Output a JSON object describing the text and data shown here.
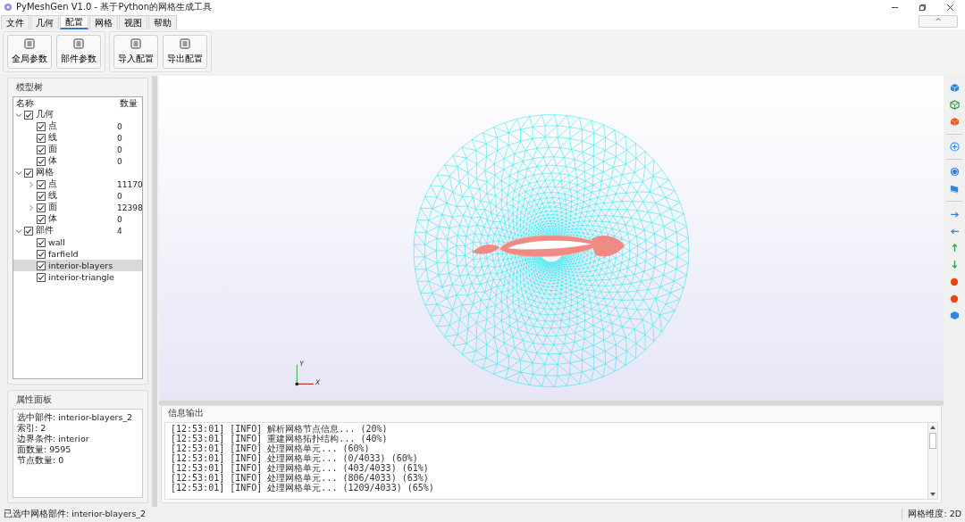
{
  "window": {
    "title": "PyMeshGen V1.0 - 基于Python的网格生成工具"
  },
  "menu_tabs": [
    {
      "label": "文件",
      "selected": false
    },
    {
      "label": "几何",
      "selected": false
    },
    {
      "label": "配置",
      "selected": true
    },
    {
      "label": "网格",
      "selected": false
    },
    {
      "label": "视图",
      "selected": false
    },
    {
      "label": "帮助",
      "selected": false
    }
  ],
  "collapse_button": {
    "label": "^"
  },
  "toolbar": {
    "groups": [
      [
        "全局参数",
        "部件参数"
      ],
      [
        "导入配置",
        "导出配置"
      ]
    ]
  },
  "model_tree": {
    "title": "模型树",
    "columns": [
      "名称",
      "数量"
    ],
    "items": [
      {
        "label": "几何",
        "checked": true,
        "expanded": true,
        "selected": false,
        "children": [
          {
            "label": "点",
            "count": "0",
            "checked": true,
            "selected": false
          },
          {
            "label": "线",
            "count": "0",
            "checked": true,
            "selected": false
          },
          {
            "label": "面",
            "count": "0",
            "checked": true,
            "selected": false
          },
          {
            "label": "体",
            "count": "0",
            "checked": true,
            "selected": false
          }
        ]
      },
      {
        "label": "网格",
        "checked": true,
        "expanded": true,
        "selected": false,
        "children": [
          {
            "label": "点",
            "count": "11170",
            "checked": true,
            "expanded": false,
            "selected": false
          },
          {
            "label": "线",
            "count": "0",
            "checked": true,
            "selected": false
          },
          {
            "label": "面",
            "count": "12398",
            "checked": true,
            "expanded": false,
            "selected": false
          },
          {
            "label": "体",
            "count": "0",
            "checked": true,
            "selected": false
          }
        ]
      },
      {
        "label": "部件",
        "count": "4",
        "checked": true,
        "expanded": true,
        "selected": false,
        "children": [
          {
            "label": "wall",
            "checked": true,
            "selected": false
          },
          {
            "label": "farfield",
            "checked": true,
            "selected": false
          },
          {
            "label": "interior-blayers",
            "checked": true,
            "selected": true
          },
          {
            "label": "interior-triangle",
            "checked": true,
            "selected": false
          }
        ]
      }
    ]
  },
  "properties": {
    "title": "属性面板",
    "lines": [
      "选中部件: interior-blayers_2",
      "索引: 2",
      "边界条件: interior",
      "面数量: 9595",
      "节点数量: 0"
    ]
  },
  "viewport": {
    "axes": {
      "y_label": "Y",
      "x_label": "X"
    }
  },
  "log": {
    "title": "信息输出",
    "lines": [
      "[12:53:01] [INFO] 解析网格节点信息... (20%)",
      "[12:53:01] [INFO] 重建网格拓扑结构... (40%)",
      "[12:53:01] [INFO] 处理网格单元... (60%)",
      "[12:53:01] [INFO] 处理网格单元... (0/4033) (60%)",
      "[12:53:01] [INFO] 处理网格单元... (403/4033) (61%)",
      "[12:53:01] [INFO] 处理网格单元... (806/4033) (63%)",
      "[12:53:01] [INFO] 处理网格单元... (1209/4033) (65%)"
    ]
  },
  "status_bar": {
    "message": "已选中网格部件: interior-blayers_2",
    "dimension": "网格维度: 2D"
  }
}
